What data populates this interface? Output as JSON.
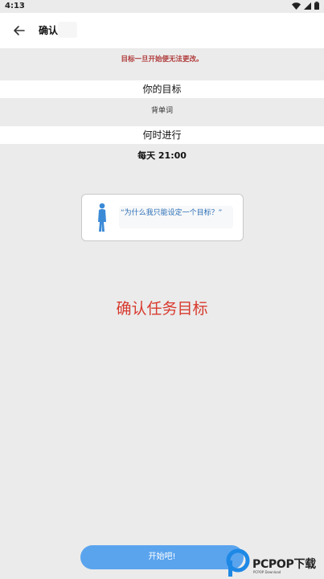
{
  "status_bar": {
    "time": "4:13"
  },
  "app_bar": {
    "title": "确认"
  },
  "warning": "目标一旦开始便无法更改。",
  "goal_section": {
    "header": "你的目标",
    "value": "背单词"
  },
  "when_section": {
    "header": "何时进行",
    "value": "每天 21:00"
  },
  "why_card": {
    "text": "“为什么我只能设定一个目标？”"
  },
  "confirm_title": "确认任务目标",
  "start_button": {
    "label": "开始吧!"
  },
  "watermark": {
    "text": "PCPOP下载",
    "sub": "PCPOP Download"
  },
  "colors": {
    "background": "#ebebeb",
    "warning": "#b03a3a",
    "accent_red": "#d83a2e",
    "button": "#5aa4ee",
    "link": "#2c6fb7"
  }
}
